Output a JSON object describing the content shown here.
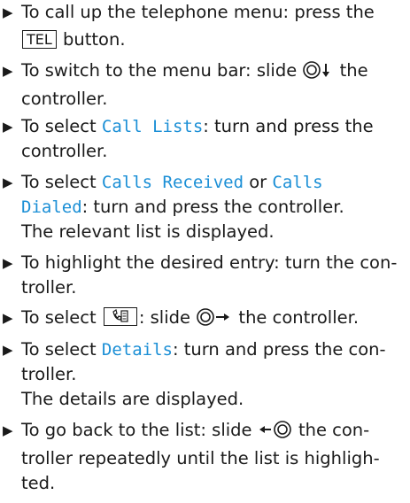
{
  "steps": [
    {
      "pre": "To call up the telephone menu: press the",
      "key": "TEL",
      "post": "button."
    },
    {
      "pre": "To switch to the menu bar: slide",
      "post": "the",
      "cont": "controller."
    },
    {
      "pre": "To select",
      "term": "Call Lists",
      "post": ": turn and press the",
      "cont": "controller."
    },
    {
      "pre": "To select",
      "term1": "Calls",
      "cont_term": "Dialed",
      "or": "or",
      "term_a": "Calls Received",
      "post": ": turn and press the controller.",
      "result": "The relevant list is displayed."
    },
    {
      "line1": "To highlight the desired entry: turn the con-",
      "line2": "troller."
    },
    {
      "pre": "To select",
      "post": ": slide",
      "tail": "the controller."
    },
    {
      "pre": "To select",
      "term": "Details",
      "post": ": turn and press the con-",
      "cont": "troller.",
      "result": "The details are displayed."
    },
    {
      "pre": "To go back to the list: slide",
      "post": "the con-",
      "line2": "troller repeatedly until the list is highligh-",
      "line3": "ted."
    }
  ],
  "icons": [
    "bullet-arrow-icon",
    "controller-icon",
    "phonebook-icon"
  ],
  "colors": {
    "accent": "#1b8fd6",
    "text": "#1a1a1a"
  }
}
